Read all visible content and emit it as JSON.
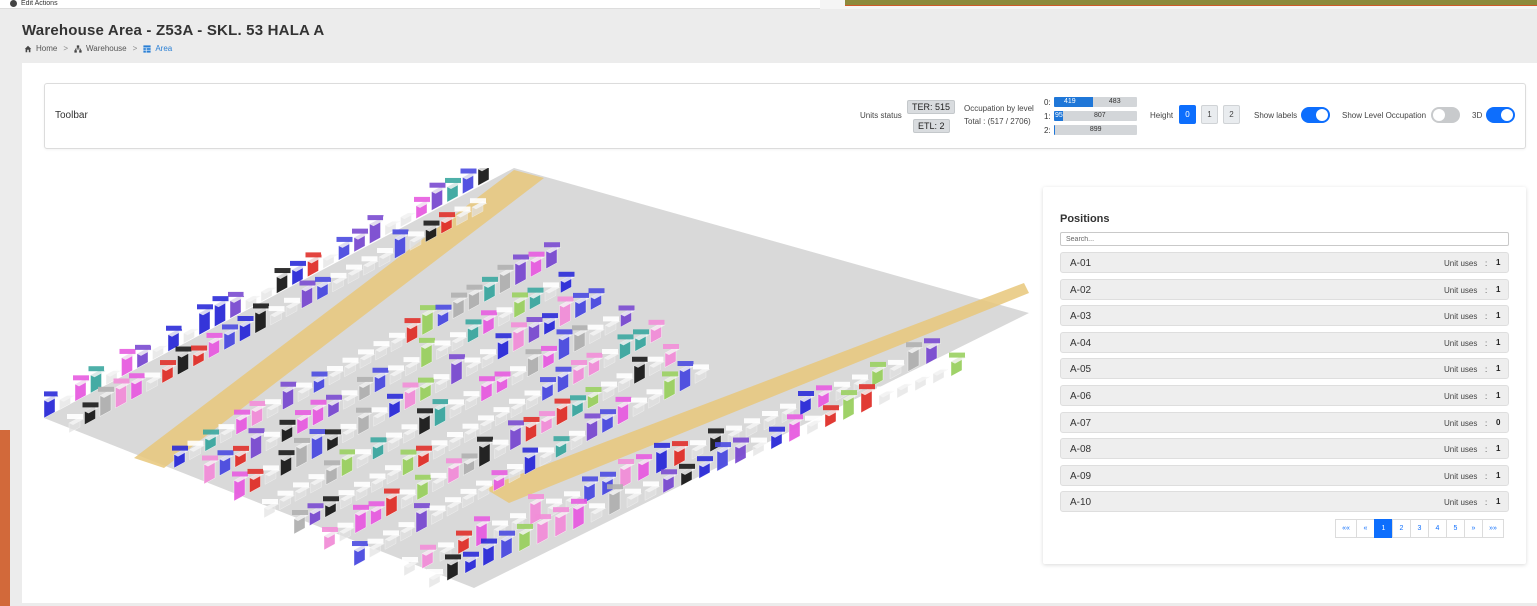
{
  "top": {
    "tab_label": "Edit Actions"
  },
  "page": {
    "title": "Warehouse Area - Z53A - SKL. 53 HALA A"
  },
  "breadcrumb": [
    {
      "label": "Home",
      "icon": "home-icon"
    },
    {
      "label": "Warehouse",
      "icon": "sitemap-icon"
    },
    {
      "label": "Area",
      "icon": "table-icon"
    }
  ],
  "toolbar": {
    "title": "Toolbar",
    "units_status_label": "Units status",
    "ter_badge": "TER: 515",
    "etl_badge": "ETL: 2",
    "occupation_label": "Occupation by level",
    "occupation_total": "Total : (517 / 2706)",
    "levels": [
      {
        "label": "0:",
        "used": "419",
        "free": "483",
        "fraction": 0.464
      },
      {
        "label": "1:",
        "used": "95",
        "free": "807",
        "fraction": 0.105
      },
      {
        "label": "2:",
        "used": "",
        "free": "899",
        "fraction": 0.004
      }
    ],
    "height_label": "Height",
    "height_options": [
      "0",
      "1",
      "2"
    ],
    "height_selected": "0",
    "show_labels_label": "Show labels",
    "show_labels_on": true,
    "show_level_occupation_label": "Show Level Occupation",
    "show_level_occupation_on": false,
    "three_d_label": "3D",
    "three_d_on": true
  },
  "positions": {
    "title": "Positions",
    "search_placeholder": "Search...",
    "unit_uses_label": "Unit uses",
    "colon": ":",
    "items": [
      {
        "id": "A-01",
        "count": "1"
      },
      {
        "id": "A-02",
        "count": "1"
      },
      {
        "id": "A-03",
        "count": "1"
      },
      {
        "id": "A-04",
        "count": "1"
      },
      {
        "id": "A-05",
        "count": "1"
      },
      {
        "id": "A-06",
        "count": "1"
      },
      {
        "id": "A-07",
        "count": "0"
      },
      {
        "id": "A-08",
        "count": "1"
      },
      {
        "id": "A-09",
        "count": "1"
      },
      {
        "id": "A-10",
        "count": "1"
      }
    ],
    "pagination": [
      "««",
      "«",
      "1",
      "2",
      "3",
      "4",
      "5",
      "»",
      "»»"
    ],
    "current_page": "1"
  },
  "colors": {
    "accent": "#0d6efd",
    "aisle": "#e8c77a",
    "rack_box": "#e2e2e2",
    "unit_colors": [
      "#e75ce0",
      "#2b2bd8",
      "#1a1a1a",
      "#e0302a",
      "#3ba7a0",
      "#9ad060",
      "#7a4ad0",
      "#f28ed8",
      "#4a4ae0",
      "#b0b0b0"
    ]
  }
}
